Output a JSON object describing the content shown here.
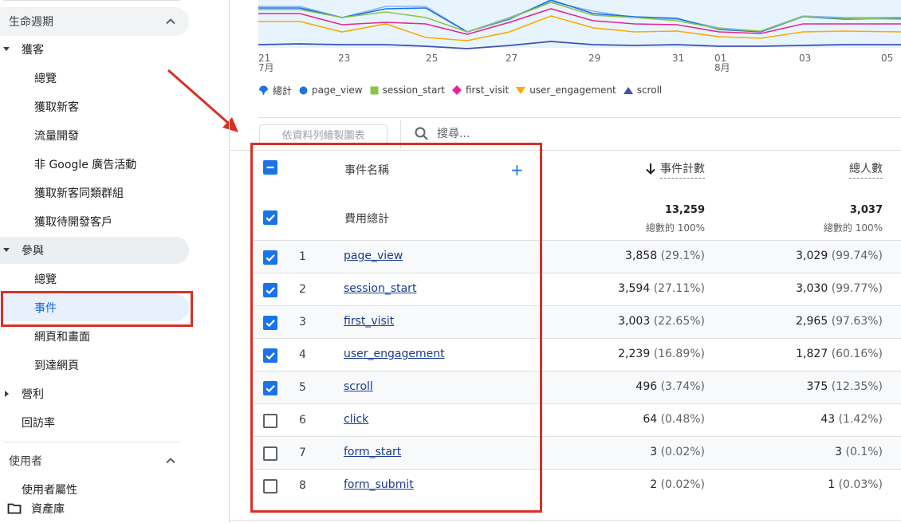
{
  "sidebar": {
    "section_lifecycle": "生命週期",
    "group_acquisition": "獲客",
    "acq_items": [
      "總覽",
      "獲取新客",
      "流量開發",
      "非 Google 廣告活動",
      "獲取新客同類群組",
      "獲取待開發客戶"
    ],
    "group_engagement": "參與",
    "eng_items": [
      "總覽",
      "事件",
      "網頁和畫面",
      "到達網頁"
    ],
    "group_monetization": "營利",
    "group_retention": "回訪率",
    "section_user": "使用者",
    "user_sub_partial": "使用者屬性",
    "library": "資產庫"
  },
  "chart": {
    "x_ticks": [
      {
        "label": "21",
        "sub": "7月"
      },
      {
        "label": "23",
        "sub": ""
      },
      {
        "label": "25",
        "sub": ""
      },
      {
        "label": "27",
        "sub": ""
      },
      {
        "label": "29",
        "sub": ""
      },
      {
        "label": "31",
        "sub": ""
      },
      {
        "label": "01",
        "sub": "8月"
      },
      {
        "label": "03",
        "sub": ""
      },
      {
        "label": "05",
        "sub": ""
      }
    ],
    "legend": [
      {
        "name": "總計",
        "color": "#1a73e8",
        "shape": "balloon-icon"
      },
      {
        "name": "page_view",
        "color": "#1a73e8",
        "shape": "circle-icon"
      },
      {
        "name": "session_start",
        "color": "#8bc34a",
        "shape": "square-icon"
      },
      {
        "name": "first_visit",
        "color": "#e52592",
        "shape": "diamond-icon"
      },
      {
        "name": "user_engagement",
        "color": "#f9ab00",
        "shape": "triangle-down-icon"
      },
      {
        "name": "scroll",
        "color": "#3f51b5",
        "shape": "triangle-up-icon"
      }
    ]
  },
  "toolbar": {
    "plot_button": "依資料列繪製圖表",
    "search_placeholder": "搜尋..."
  },
  "table": {
    "col_name": "事件名稱",
    "col_count": "事件計數",
    "col_users": "總人數",
    "total_label": "費用總計",
    "total_count": "13,259",
    "total_count_sub": "總數的 100%",
    "total_users": "3,037",
    "total_users_sub": "總數的 100%",
    "rows": [
      {
        "n": "1",
        "name": "page_view",
        "count": "3,858",
        "count_pct": "(29.1%)",
        "users": "3,029",
        "users_pct": "(99.74%)",
        "checked": true
      },
      {
        "n": "2",
        "name": "session_start",
        "count": "3,594",
        "count_pct": "(27.11%)",
        "users": "3,030",
        "users_pct": "(99.77%)",
        "checked": true
      },
      {
        "n": "3",
        "name": "first_visit",
        "count": "3,003",
        "count_pct": "(22.65%)",
        "users": "2,965",
        "users_pct": "(97.63%)",
        "checked": true
      },
      {
        "n": "4",
        "name": "user_engagement",
        "count": "2,239",
        "count_pct": "(16.89%)",
        "users": "1,827",
        "users_pct": "(60.16%)",
        "checked": true
      },
      {
        "n": "5",
        "name": "scroll",
        "count": "496",
        "count_pct": "(3.74%)",
        "users": "375",
        "users_pct": "(12.35%)",
        "checked": true
      },
      {
        "n": "6",
        "name": "click",
        "count": "64",
        "count_pct": "(0.48%)",
        "users": "43",
        "users_pct": "(1.42%)",
        "checked": false
      },
      {
        "n": "7",
        "name": "form_start",
        "count": "3",
        "count_pct": "(0.02%)",
        "users": "3",
        "users_pct": "(0.1%)",
        "checked": false
      },
      {
        "n": "8",
        "name": "form_submit",
        "count": "2",
        "count_pct": "(0.02%)",
        "users": "1",
        "users_pct": "(0.03%)",
        "checked": false
      }
    ]
  }
}
